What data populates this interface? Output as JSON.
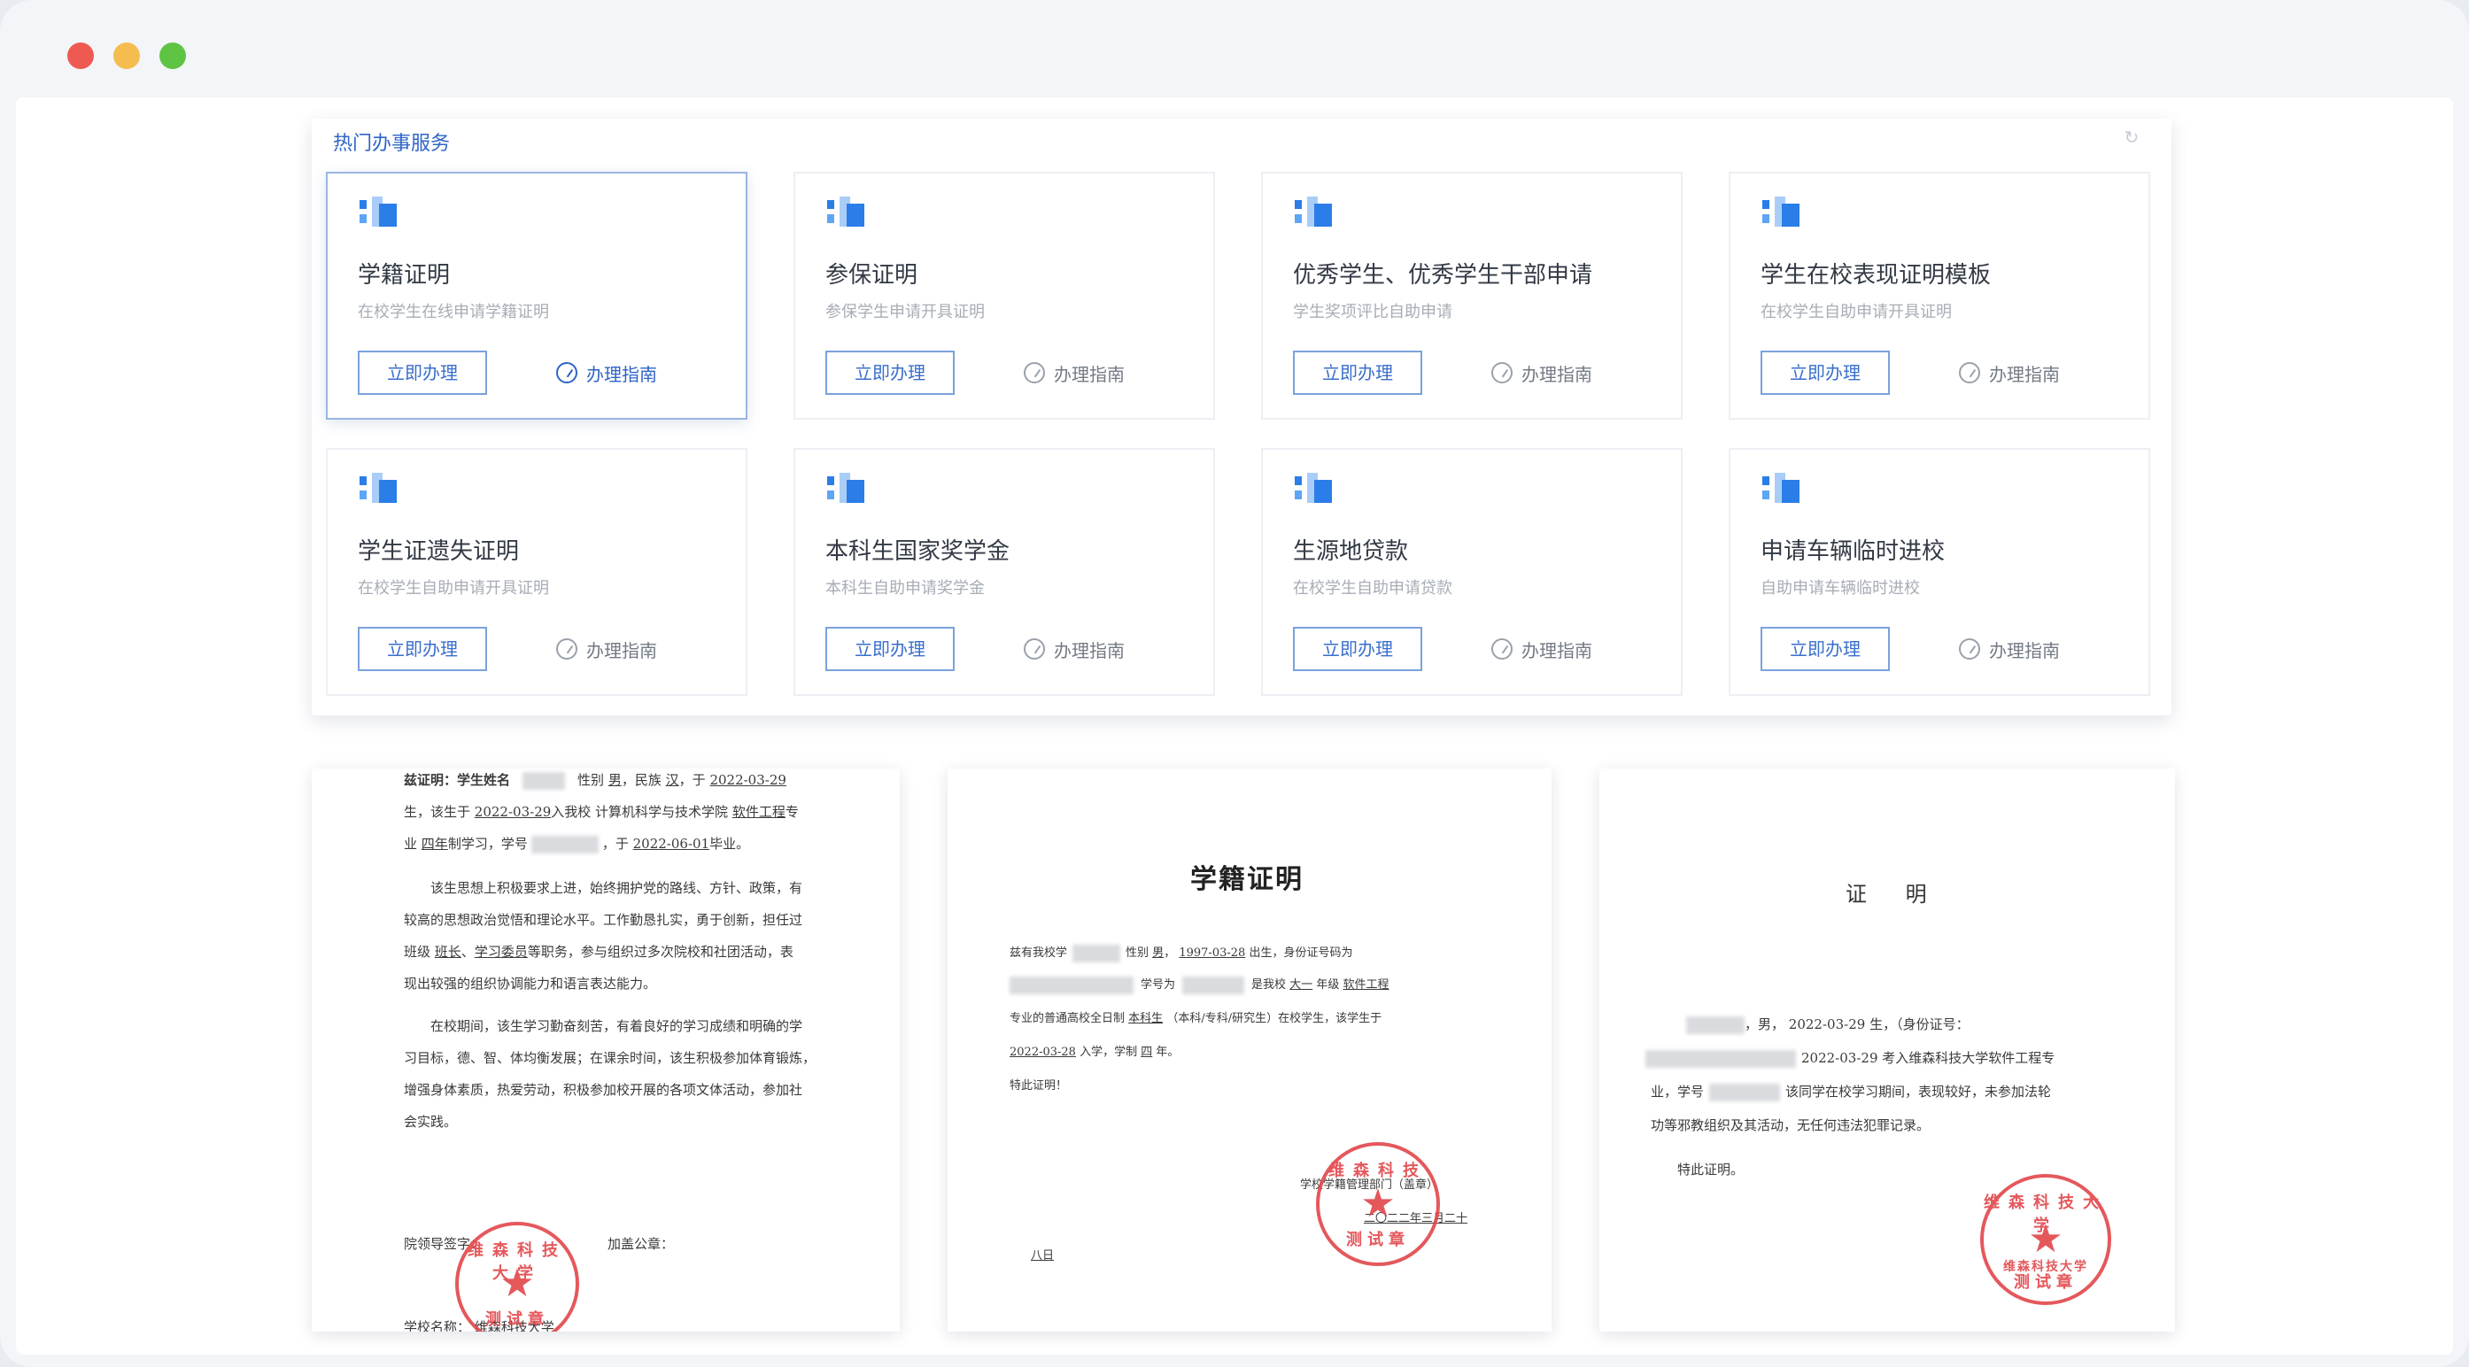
{
  "window": {
    "controls": [
      "close",
      "minimize",
      "maximize"
    ],
    "colors": {
      "close": "#ee5a52",
      "minimize": "#f5bd4f",
      "maximize": "#5fc444"
    }
  },
  "services": {
    "title": "热门办事服务",
    "refresh_icon": "refresh-icon",
    "go_label": "立即办理",
    "guide_label": "办理指南",
    "accent": "#2f64c7",
    "cards": [
      {
        "title": "学籍证明",
        "desc": "在校学生在线申请学籍证明"
      },
      {
        "title": "参保证明",
        "desc": "参保学生申请开具证明"
      },
      {
        "title": "优秀学生、优秀学生干部申请",
        "desc": "学生奖项评比自助申请"
      },
      {
        "title": "学生在校表现证明模板",
        "desc": "在校学生自助申请开具证明"
      },
      {
        "title": "学生证遗失证明",
        "desc": "在校学生自助申请开具证明"
      },
      {
        "title": "本科生国家奖学金",
        "desc": "本科生自助申请奖学金"
      },
      {
        "title": "生源地贷款",
        "desc": "在校学生自助申请贷款"
      },
      {
        "title": "申请车辆临时进校",
        "desc": "自助申请车辆临时进校"
      }
    ]
  },
  "doc1": {
    "l1_a": "兹证明：学生姓名",
    "l1_b": "性别",
    "l1_gender": "男",
    "l1_c": "，民族",
    "l1_ethnic": "汉",
    "l1_d": "，于",
    "l1_date": "2022-03-29",
    "l2_a": "生，该生于",
    "l2_date": "2022-03-29",
    "l2_b": "入我校 计算机科学与技术学院",
    "l2_major": "软件工程",
    "l2_c": "专",
    "l3_a": "业",
    "l3_years": "四年",
    "l3_b": "制学习，学号",
    "l3_c": "，于",
    "l3_date": "2022-06-01",
    "l3_d": "毕业。",
    "p2_1": "该生思想上积极要求上进，始终拥护党的路线、方针、政策，有",
    "p2_2": "较高的思想政治觉悟和理论水平。工作勤恳扎实，勇于创新，担任过",
    "p2_3a": "班级",
    "p2_role1": "班长",
    "p2_3b": "、",
    "p2_role2": "学习委员",
    "p2_3c": "等职务，参与组织过多次院校和社团活动，表",
    "p2_4": "现出较强的组织协调能力和语言表达能力。",
    "p3_1": "在校期间，该生学习勤奋刻苦，有着良好的学习成绩和明确的学",
    "p3_2": "习目标，德、智、体均衡发展；在课余时间，该生积极参加体育锻炼，",
    "p3_3": "增强身体素质，热爱劳动，积极参加校开展的各项文体活动，参加社",
    "p3_4": "会实践。",
    "sign_a": "院领导签字：",
    "sign_b": "加盖公章：",
    "school_a": "学校名称：",
    "school_b": "维森科技大学",
    "seal_top": "维森科技大学",
    "seal_bottom": "测试章"
  },
  "doc2": {
    "heading": "学籍证明",
    "l1_a": "兹有我校学",
    "l1_b": "性别",
    "l1_gender": "男",
    "l1_c": "，",
    "l1_birth": "1997-03-28",
    "l1_d": "出生，身份证号码为",
    "l2_a": "学号为",
    "l2_b": "是我校",
    "l2_grade": "大一",
    "l2_c": "年级",
    "l2_major": "软件工程",
    "l3_a": "专业的普通高校全日制",
    "l3_level": "本科生",
    "l3_b": "（本科/专科/研究生）在校学生，该学生于",
    "l4_date": "2022-03-28",
    "l4_a": "入学，学制",
    "l4_years": "四",
    "l4_b": "年。",
    "l5": "特此证明！",
    "dept": "学校学籍管理部门（盖章）",
    "date_cn": "二〇二二年三月二十",
    "footer": "八日",
    "seal_top": "维森科技",
    "seal_bottom": "测试章"
  },
  "doc3": {
    "heading": "证 明",
    "l1_a": "，男，",
    "l1_date": "2022-03-29",
    "l1_b": "生，（身份证号：",
    "l2_a": "2022-03-29 考入维森科技大学软件工程专",
    "l3_a": "业，学号",
    "l3_b": "该同学在校学习期间，表现较好，未参加法轮",
    "l4": "功等邪教组织及其活动，无任何违法犯罪记录。",
    "l5": "特此证明。",
    "seal_top": "维森科技大学",
    "seal_mid": "维森科技大学",
    "seal_bottom": "测试章"
  }
}
